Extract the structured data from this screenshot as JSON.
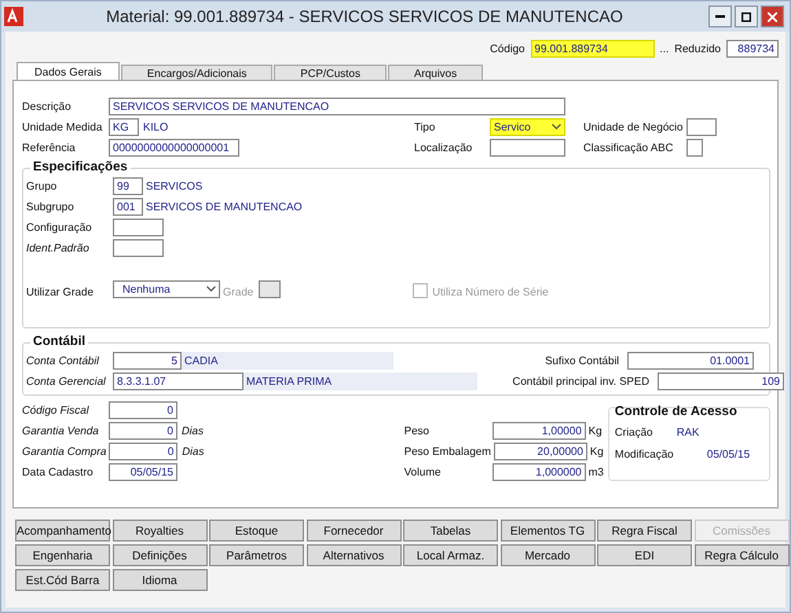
{
  "window": {
    "title": "Material: 99.001.889734 - SERVICOS SERVICOS DE MANUTENCAO"
  },
  "header": {
    "codigo": {
      "label": "Código",
      "value": "99.001.889734",
      "highlighted": true
    },
    "lookup": "...",
    "reduzido": {
      "label": "Reduzido",
      "value": "889734"
    }
  },
  "tabs": [
    {
      "label": "Dados Gerais",
      "selected": true
    },
    {
      "label": "Encargos/Adicionais",
      "selected": false
    },
    {
      "label": "PCP/Custos",
      "selected": false
    },
    {
      "label": "Arquivos",
      "selected": false
    }
  ],
  "general": {
    "descricao": {
      "label": "Descrição",
      "value": "SERVICOS SERVICOS DE MANUTENCAO"
    },
    "unidade_medida": {
      "label": "Unidade Medida",
      "code": "KG",
      "name": "KILO"
    },
    "referencia": {
      "label": "Referência",
      "value": "0000000000000000001"
    },
    "tipo": {
      "label": "Tipo",
      "value": "Servico",
      "highlighted": true
    },
    "localizacao": {
      "label": "Localização"
    },
    "unidade_negocio": {
      "label": "Unidade de Negócio"
    },
    "classificacao_abc": {
      "label": "Classificação ABC"
    }
  },
  "especificacoes": {
    "title": "Especificações",
    "grupo": {
      "label": "Grupo",
      "code": "99",
      "name": "SERVICOS"
    },
    "subgrupo": {
      "label": "Subgrupo",
      "code": "001",
      "name": "SERVICOS DE MANUTENCAO"
    },
    "configuracao": {
      "label": "Configuração",
      "italic": false
    },
    "ident_padrao": {
      "label": "Ident.Padrão",
      "italic": true
    },
    "utilizar_grade": {
      "label": "Utilizar Grade",
      "value": "Nenhuma"
    },
    "grade": {
      "label": "Grade",
      "disabled": true
    },
    "numero_serie": {
      "label": "Utiliza Número de Série",
      "checked": false,
      "disabled": true
    }
  },
  "contabil": {
    "title": "Contábil",
    "conta_contabil": {
      "label": "Conta Contábil",
      "code": "5",
      "name": "CADIA",
      "italic": true
    },
    "conta_gerencial": {
      "label": "Conta Gerencial",
      "code": "8.3.3.1.07",
      "name": "MATERIA PRIMA",
      "italic": true
    },
    "sufixo": {
      "label": "Sufixo Contábil",
      "value": "01.0001"
    },
    "sped": {
      "label": "Contábil principal inv. SPED",
      "value": "109"
    }
  },
  "fiscal": [
    {
      "label": "Código Fiscal",
      "value": "0",
      "italic": true
    },
    {
      "label": "Garantia Venda",
      "value": "0",
      "unit": "Dias",
      "italic": true
    },
    {
      "label": "Garantia Compra",
      "value": "0",
      "unit": "Dias",
      "italic": true
    },
    {
      "label": "Data Cadastro",
      "value": "05/05/15",
      "italic": false
    }
  ],
  "medidas": [
    {
      "label": "Peso",
      "value": "1,00000",
      "unit": "Kg"
    },
    {
      "label": "Peso Embalagem",
      "value": "20,00000",
      "unit": "Kg"
    },
    {
      "label": "Volume",
      "value": "1,000000",
      "unit": "m3"
    }
  ],
  "controle": {
    "title": "Controle de Acesso",
    "criacao": {
      "label": "Criação",
      "value": "RAK"
    },
    "modificacao": {
      "label": "Modificação",
      "value": "05/05/15"
    }
  },
  "buttons": [
    {
      "label": "Acompanhamento",
      "disabled": false
    },
    {
      "label": "Royalties",
      "disabled": false
    },
    {
      "label": "Estoque",
      "disabled": false
    },
    {
      "label": "Fornecedor",
      "disabled": false
    },
    {
      "label": "Tabelas",
      "disabled": false
    },
    {
      "label": "Elementos TG",
      "disabled": false
    },
    {
      "label": "Regra Fiscal",
      "disabled": false
    },
    {
      "label": "Comissões",
      "disabled": true
    },
    {
      "label": "Engenharia",
      "disabled": false
    },
    {
      "label": "Definições",
      "disabled": false
    },
    {
      "label": "Parâmetros",
      "disabled": false
    },
    {
      "label": "Alternativos",
      "disabled": false
    },
    {
      "label": "Local Armaz.",
      "disabled": false
    },
    {
      "label": "Mercado",
      "disabled": false
    },
    {
      "label": "EDI",
      "disabled": false
    },
    {
      "label": "Regra Cálculo",
      "disabled": false
    },
    {
      "label": "Est.Cód Barra",
      "disabled": false
    },
    {
      "label": "Idioma",
      "disabled": false
    }
  ]
}
